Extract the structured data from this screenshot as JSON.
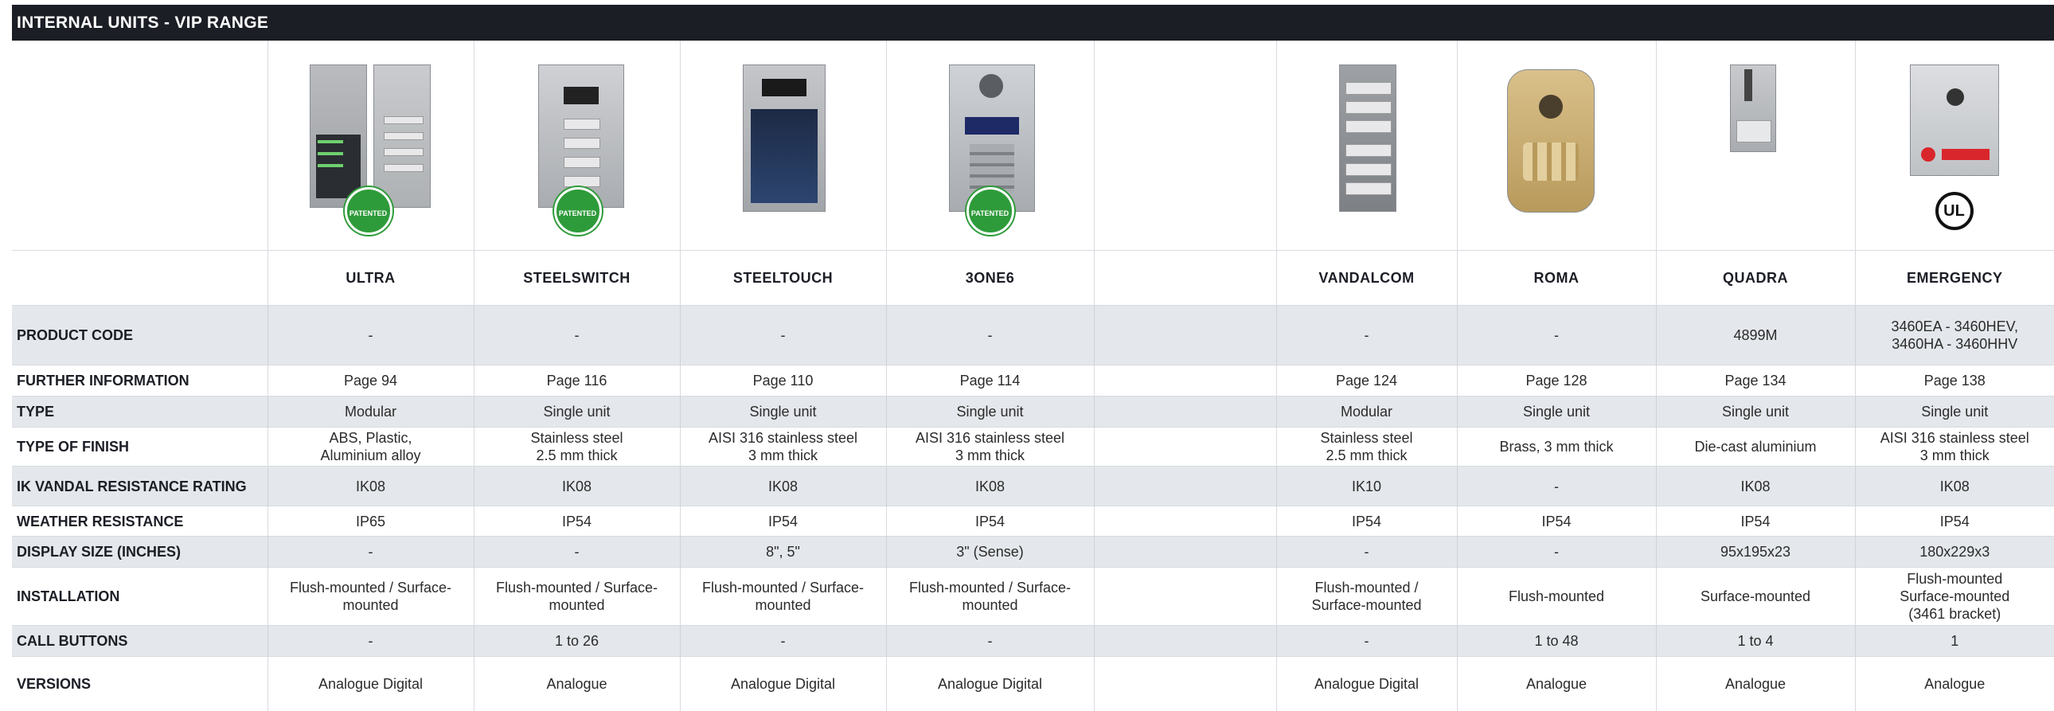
{
  "header": {
    "title": "INTERNAL UNITS - VIP RANGE"
  },
  "badges": {
    "patented": "PATENTED",
    "ul": "UL"
  },
  "products": [
    {
      "name": "ULTRA",
      "product_code": "-",
      "further_information": "Page 94",
      "type": "Modular",
      "type_of_finish": "ABS, Plastic,\nAluminium alloy",
      "ik_rating": "IK08",
      "weather_resistance": "IP65",
      "display_size": "-",
      "installation": "Flush-mounted / Surface-\nmounted",
      "call_buttons": "-",
      "versions": "Analogue Digital"
    },
    {
      "name": "STEELSWITCH",
      "product_code": "-",
      "further_information": "Page 116",
      "type": "Single unit",
      "type_of_finish": "Stainless steel\n2.5 mm thick",
      "ik_rating": "IK08",
      "weather_resistance": "IP54",
      "display_size": "-",
      "installation": "Flush-mounted / Surface-\nmounted",
      "call_buttons": "1 to 26",
      "versions": "Analogue"
    },
    {
      "name": "STEELTOUCH",
      "product_code": "-",
      "further_information": "Page 110",
      "type": "Single unit",
      "type_of_finish": "AISI 316 stainless steel\n3 mm thick",
      "ik_rating": "IK08",
      "weather_resistance": "IP54",
      "display_size": "8\", 5\"",
      "installation": "Flush-mounted / Surface-\nmounted",
      "call_buttons": "-",
      "versions": "Analogue Digital"
    },
    {
      "name": "3ONE6",
      "product_code": "-",
      "further_information": "Page 114",
      "type": "Single unit",
      "type_of_finish": "AISI 316 stainless steel\n3 mm thick",
      "ik_rating": "IK08",
      "weather_resistance": "IP54",
      "display_size": "3\" (Sense)",
      "installation": "Flush-mounted / Surface-\nmounted",
      "call_buttons": "-",
      "versions": "Analogue Digital"
    },
    {
      "name": "",
      "product_code": "",
      "further_information": "",
      "type": "",
      "type_of_finish": "",
      "ik_rating": "",
      "weather_resistance": "",
      "display_size": "",
      "installation": "",
      "call_buttons": "",
      "versions": ""
    },
    {
      "name": "VANDALCOM",
      "product_code": "-",
      "further_information": "Page 124",
      "type": "Modular",
      "type_of_finish": "Stainless steel\n2.5 mm thick",
      "ik_rating": "IK10",
      "weather_resistance": "IP54",
      "display_size": "-",
      "installation": "Flush-mounted /\nSurface-mounted",
      "call_buttons": "-",
      "versions": "Analogue Digital"
    },
    {
      "name": "ROMA",
      "product_code": "-",
      "further_information": "Page 128",
      "type": "Single unit",
      "type_of_finish": "Brass, 3 mm thick",
      "ik_rating": "-",
      "weather_resistance": "IP54",
      "display_size": "-",
      "installation": "Flush-mounted",
      "call_buttons": "1 to 48",
      "versions": "Analogue"
    },
    {
      "name": "QUADRA",
      "product_code": "4899M",
      "further_information": "Page 134",
      "type": "Single unit",
      "type_of_finish": "Die-cast aluminium",
      "ik_rating": "IK08",
      "weather_resistance": "IP54",
      "display_size": "95x195x23",
      "installation": "Surface-mounted",
      "call_buttons": "1 to 4",
      "versions": "Analogue"
    },
    {
      "name": "EMERGENCY",
      "product_code": "3460EA - 3460HEV,\n3460HA - 3460HHV",
      "further_information": "Page 138",
      "type": "Single unit",
      "type_of_finish": "AISI 316 stainless steel\n3 mm thick",
      "ik_rating": "IK08",
      "weather_resistance": "IP54",
      "display_size": "180x229x3",
      "installation": "Flush-mounted\nSurface-mounted\n(3461 bracket)",
      "call_buttons": "1",
      "versions": "Analogue"
    }
  ],
  "row_labels": {
    "product_code": "PRODUCT CODE",
    "further_information": "FURTHER INFORMATION",
    "type": "TYPE",
    "type_of_finish": "TYPE OF FINISH",
    "ik_rating": "IK VANDAL RESISTANCE RATING",
    "weather_resistance": "WEATHER RESISTANCE",
    "display_size": "DISPLAY SIZE (INCHES)",
    "installation": "INSTALLATION",
    "call_buttons": "CALL BUTTONS",
    "versions": "VERSIONS"
  }
}
